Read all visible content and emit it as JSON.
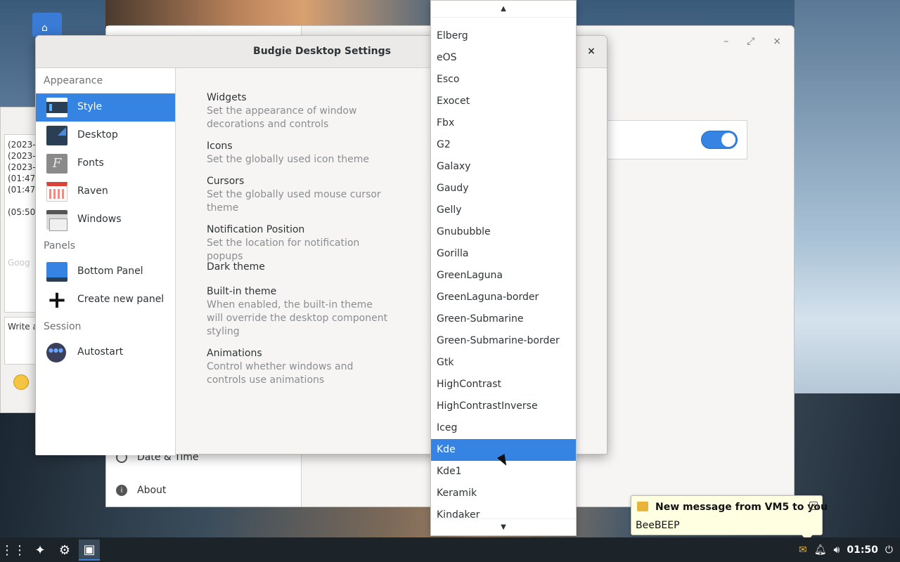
{
  "background_window": {
    "sidebar_items": [
      "Date & Time",
      "About"
    ],
    "controls": [
      "–",
      "⤢",
      "×"
    ]
  },
  "chat_window": {
    "log_lines": [
      "(2023-0",
      "(2023-0",
      "(2023-0",
      "(01:47:",
      "(01:47:",
      "",
      "(05:50:"
    ],
    "input_placeholder": "Write a",
    "faded_text": "Goog"
  },
  "dialog": {
    "title": "Budgie Desktop Settings",
    "close_label": "×",
    "sections": {
      "appearance": "Appearance",
      "panels": "Panels",
      "session": "Session"
    },
    "nav": {
      "style": "Style",
      "desktop": "Desktop",
      "fonts": "Fonts",
      "raven": "Raven",
      "windows": "Windows",
      "bottom_panel": "Bottom Panel",
      "create_panel": "Create new panel",
      "autostart": "Autostart"
    },
    "settings": [
      {
        "title": "Widgets",
        "desc": "Set the appearance of window decorations and controls"
      },
      {
        "title": "Icons",
        "desc": "Set the globally used icon theme"
      },
      {
        "title": "Cursors",
        "desc": "Set the globally used mouse cursor theme"
      },
      {
        "title": "Notification Position",
        "desc": "Set the location for notification popups"
      },
      {
        "title": "Dark theme",
        "desc": ""
      },
      {
        "title": "Built-in theme",
        "desc": "When enabled, the built-in theme will override the desktop component styling"
      },
      {
        "title": "Animations",
        "desc": "Control whether windows and controls use animations"
      }
    ]
  },
  "dropdown": {
    "items": [
      "Elberg",
      "eOS",
      "Esco",
      "Exocet",
      "Fbx",
      "G2",
      "Galaxy",
      "Gaudy",
      "Gelly",
      "Gnububble",
      "Gorilla",
      "GreenLaguna",
      "GreenLaguna-border",
      "Green-Submarine",
      "Green-Submarine-border",
      "Gtk",
      "HighContrast",
      "HighContrastInverse",
      "Iceg",
      "Kde",
      "Kde1",
      "Keramik",
      "Kindaker"
    ],
    "selected": "Kde",
    "arrow_up": "▲",
    "arrow_down": "▼"
  },
  "notification": {
    "title": "New message from VM5 to you",
    "body": "BeeBEEP",
    "close": "×"
  },
  "taskbar": {
    "clock": "01:50",
    "icons": [
      "apps-grid-icon",
      "beebeep-icon",
      "settings-gear-icon",
      "budgie-settings-icon"
    ],
    "tray": [
      "mail-icon",
      "bell-icon",
      "volume-icon",
      "power-icon"
    ]
  },
  "colors": {
    "accent": "#3584e4",
    "panel": "#1c2329",
    "notification_bg": "#ffffe1"
  }
}
